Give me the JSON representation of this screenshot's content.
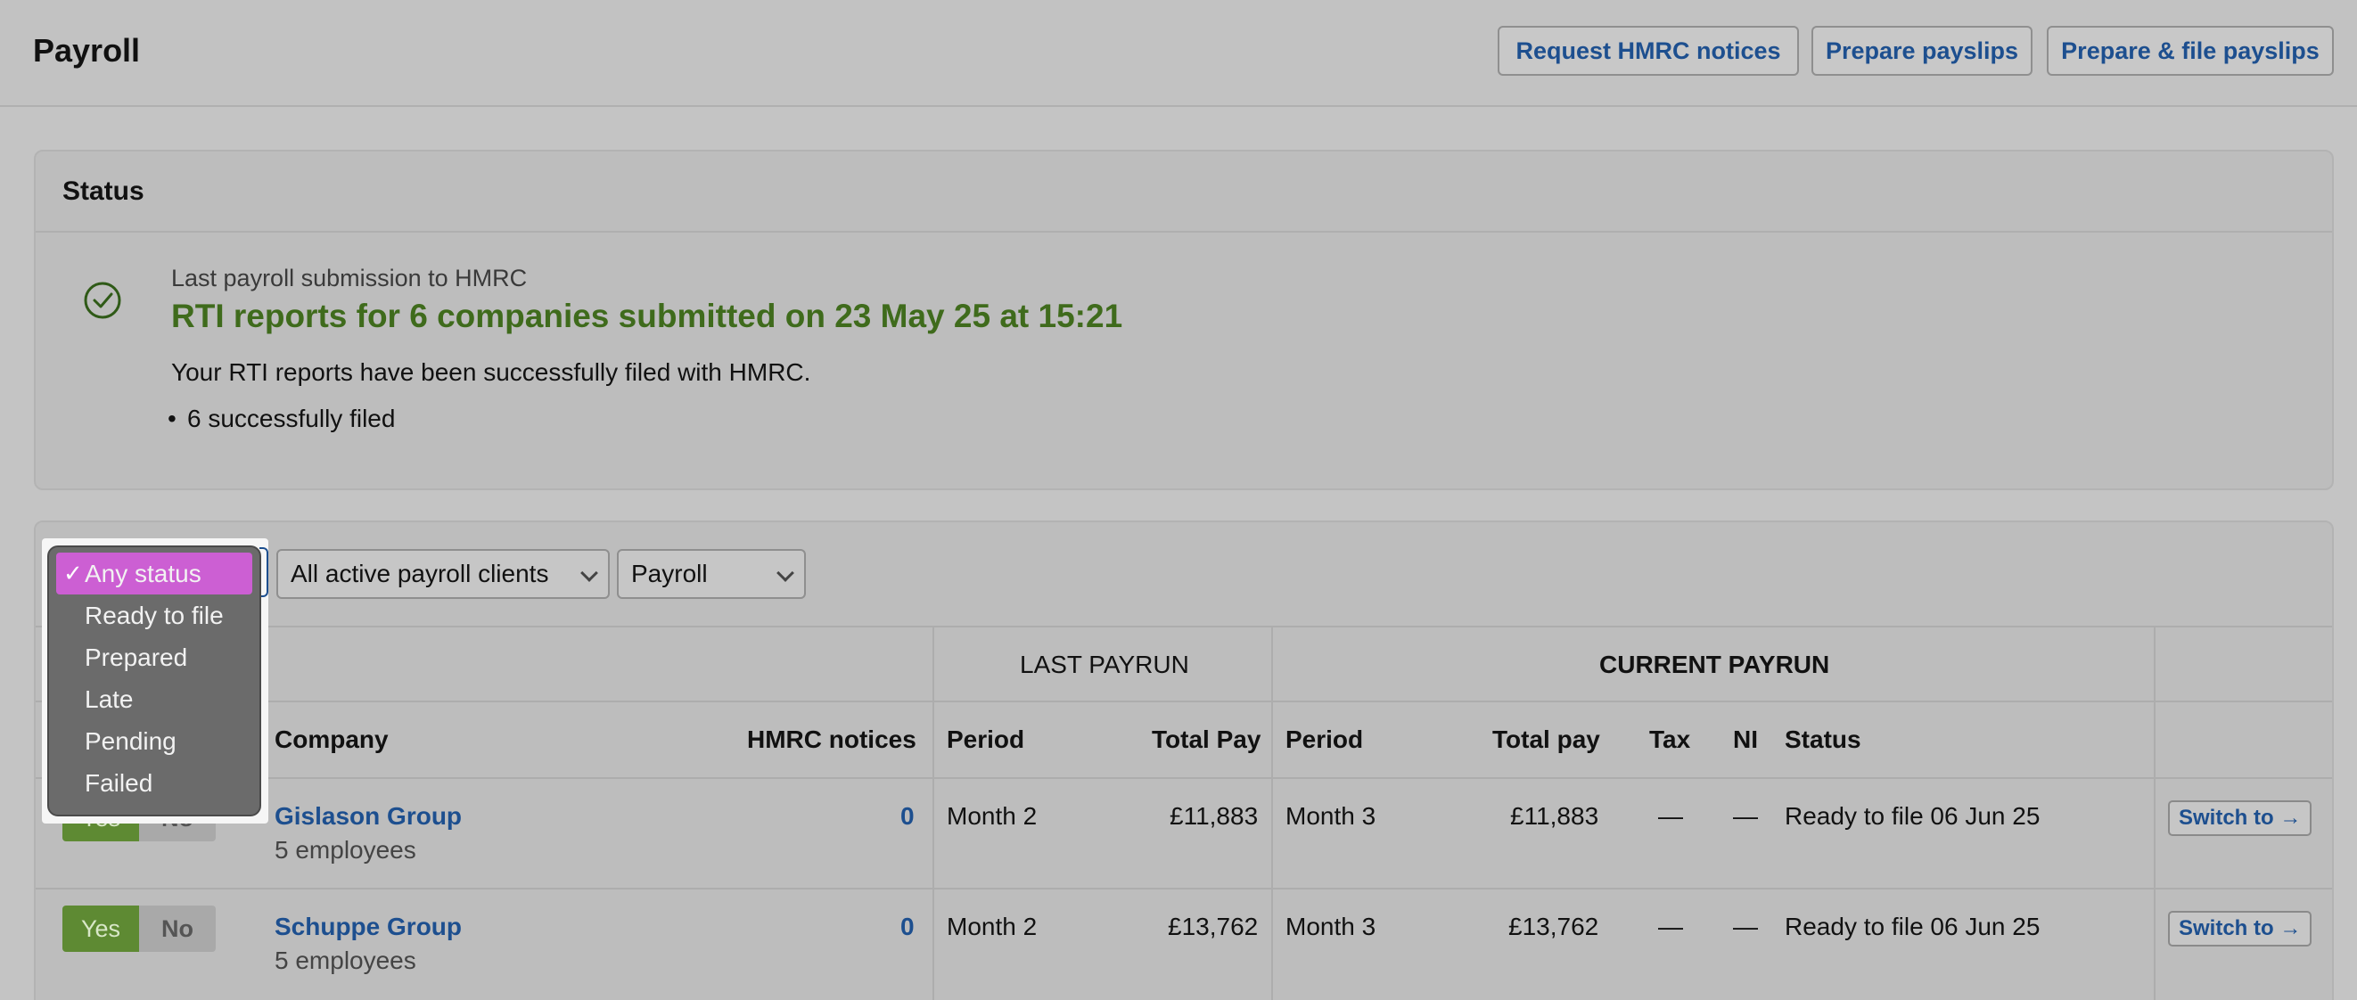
{
  "header": {
    "title": "Payroll",
    "buttons": {
      "request_notices": "Request HMRC notices",
      "prepare_payslips": "Prepare payslips",
      "prepare_file_payslips": "Prepare & file payslips"
    }
  },
  "status": {
    "heading": "Status",
    "sub_label": "Last payroll submission to HMRC",
    "headline": "RTI reports for 6 companies submitted on 23 May 25 at 15:21",
    "description": "Your RTI reports have been successfully filed with HMRC.",
    "bullet": "6 successfully filed"
  },
  "filters": {
    "status_options": [
      "Any status",
      "Ready to file",
      "Prepared",
      "Late",
      "Pending",
      "Failed"
    ],
    "status_selected": "Any status",
    "clients_selected": "All active payroll clients",
    "type_selected": "Payroll"
  },
  "table": {
    "groups": {
      "last_payrun": "LAST PAYRUN",
      "current_payrun": "CURRENT PAYRUN"
    },
    "columns": {
      "company": "Company",
      "hmrc_notices": "HMRC notices",
      "last_period": "Period",
      "last_total": "Total Pay",
      "cur_period": "Period",
      "cur_total": "Total pay",
      "tax": "Tax",
      "ni": "NI",
      "status": "Status"
    },
    "yes_label": "Yes",
    "no_label": "No",
    "switch_label": "Switch to →",
    "rows": [
      {
        "company": "Gislason Group",
        "employees": "5 employees",
        "notices": "0",
        "last_period": "Month 2",
        "last_total": "£11,883",
        "cur_period": "Month 3",
        "cur_total": "£11,883",
        "tax": "—",
        "ni": "—",
        "status": "Ready to file 06 Jun 25"
      },
      {
        "company": "Schuppe Group",
        "employees": "5 employees",
        "notices": "0",
        "last_period": "Month 2",
        "last_total": "£13,762",
        "cur_period": "Month 3",
        "cur_total": "£13,762",
        "tax": "—",
        "ni": "—",
        "status": "Ready to file 06 Jun 25"
      }
    ]
  },
  "colors": {
    "accent_link": "#1d4f8f",
    "success_green": "#3f6b1c",
    "selected_option": "#cc5fd3"
  }
}
